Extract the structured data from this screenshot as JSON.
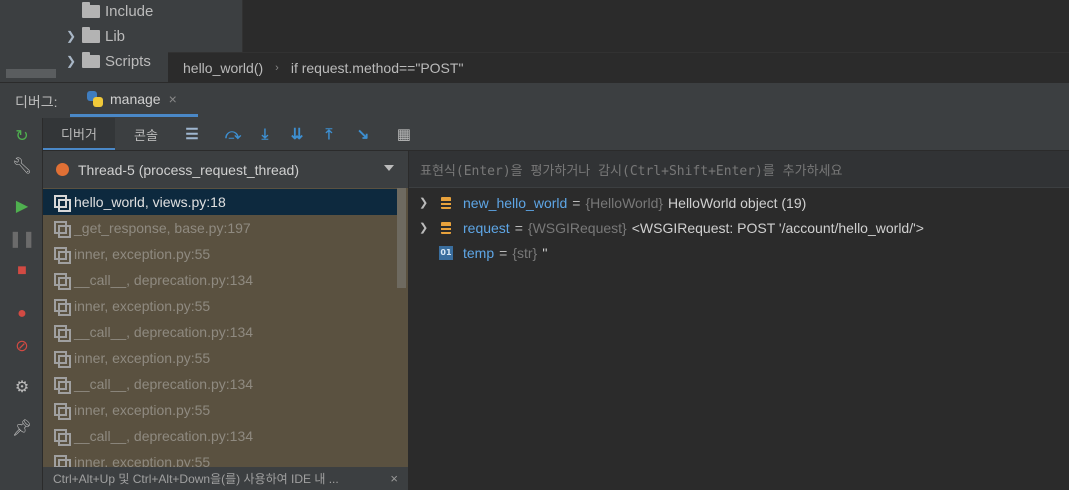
{
  "project_tree": {
    "items": [
      {
        "label": "Include",
        "has_chevron": false
      },
      {
        "label": "Lib",
        "has_chevron": true
      },
      {
        "label": "Scripts",
        "has_chevron": true
      }
    ]
  },
  "breadcrumb": {
    "items": [
      "hello_world()",
      "if request.method==\"POST\""
    ]
  },
  "debug_window": {
    "title": "디버그:",
    "config_tab": "manage",
    "close_glyph": "×"
  },
  "subtabs": {
    "debugger": "디버거",
    "console": "콘솔"
  },
  "thread": {
    "label": "Thread-5 (process_request_thread)"
  },
  "frames": [
    {
      "label": "hello_world, views.py:18",
      "selected": true
    },
    {
      "label": "_get_response, base.py:197",
      "selected": false
    },
    {
      "label": "inner, exception.py:55",
      "selected": false
    },
    {
      "label": "__call__, deprecation.py:134",
      "selected": false
    },
    {
      "label": "inner, exception.py:55",
      "selected": false
    },
    {
      "label": "__call__, deprecation.py:134",
      "selected": false
    },
    {
      "label": "inner, exception.py:55",
      "selected": false
    },
    {
      "label": "__call__, deprecation.py:134",
      "selected": false
    },
    {
      "label": "inner, exception.py:55",
      "selected": false
    },
    {
      "label": "__call__, deprecation.py:134",
      "selected": false
    },
    {
      "label": "inner, exception.py:55",
      "selected": false
    }
  ],
  "frames_footer": {
    "hint": "Ctrl+Alt+Up 및 Ctrl+Alt+Down을(를) 사용하여 IDE 내 ...",
    "close_glyph": "×"
  },
  "evaluate": {
    "placeholder": "표현식(Enter)을 평가하거나 감시(Ctrl+Shift+Enter)를 추가하세요"
  },
  "variables": [
    {
      "name": "new_hello_world",
      "eq": "=",
      "type": "{HelloWorld}",
      "value": "HelloWorld object (19)",
      "expandable": true,
      "icon": "object-icon"
    },
    {
      "name": "request",
      "eq": "=",
      "type": "{WSGIRequest}",
      "value": "<WSGIRequest: POST '/account/hello_world/'>",
      "expandable": true,
      "icon": "object-icon"
    },
    {
      "name": "temp",
      "eq": "=",
      "type": "{str}",
      "value": "''",
      "expandable": false,
      "icon": "primitive-icon",
      "icon_text": "01"
    }
  ],
  "colors": {
    "accent": "#4a88c7",
    "thread_dot": "#e07035",
    "frames_bg": "#5a5140",
    "selected_frame": "#0d293e",
    "var_name": "#5ea6e6"
  }
}
